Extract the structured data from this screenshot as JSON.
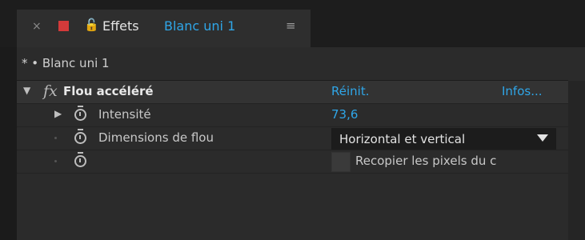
{
  "tab": {
    "close_glyph": "×",
    "lock_glyph": "🔓",
    "title": "Effets",
    "layer": "Blanc uni 1",
    "menu_glyph": "≡",
    "label_color": "#d43a3a"
  },
  "breadcrumb": "* • Blanc uni 1",
  "effect": {
    "name": "Flou accéléré",
    "fx": "fx",
    "reset": "Réinit.",
    "about": "Infos..."
  },
  "params": [
    {
      "label": "Intensité",
      "value": "73,6"
    },
    {
      "label": "Dimensions de flou",
      "value": "Horizontal et vertical"
    },
    {
      "label": "",
      "value": "Recopier les pixels du c"
    }
  ],
  "accent": "#2fa6e8"
}
